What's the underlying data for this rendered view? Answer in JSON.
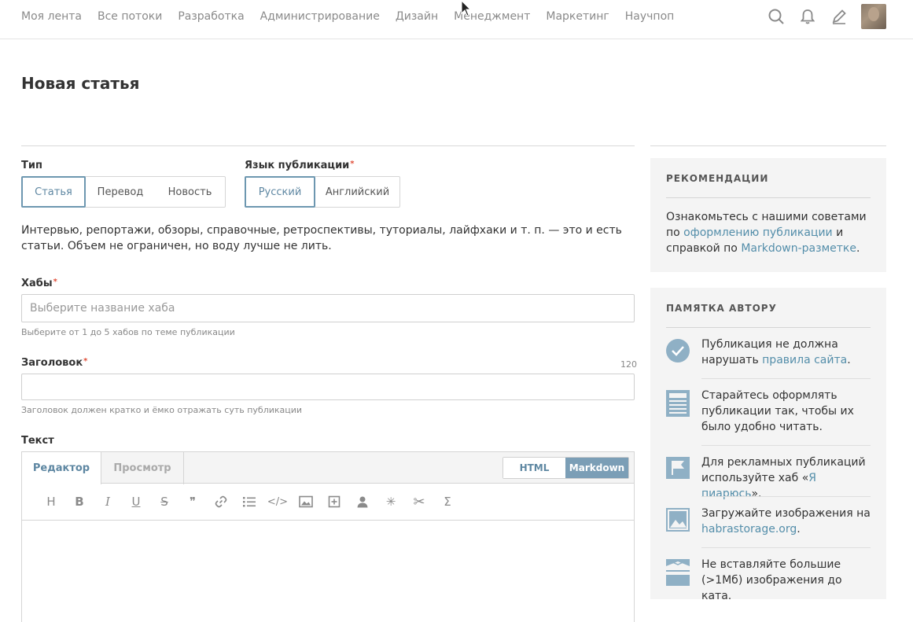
{
  "nav": {
    "items": [
      "Моя лента",
      "Все потоки",
      "Разработка",
      "Администрирование",
      "Дизайн",
      "Менеджмент",
      "Маркетинг",
      "Научпоп"
    ]
  },
  "page": {
    "title": "Новая статья"
  },
  "form": {
    "type": {
      "label": "Тип",
      "options": [
        "Статья",
        "Перевод",
        "Новость"
      ]
    },
    "language": {
      "label": "Язык публикации",
      "options": [
        "Русский",
        "Английский"
      ]
    },
    "description": "Интервью, репортажи, обзоры, справочные, ретроспективы, туториалы, лайфхаки и т. п. — это и есть статьи. Объем не ограничен, но воду лучше не лить.",
    "hubs": {
      "label": "Хабы",
      "placeholder": "Выберите название хаба",
      "hint": "Выберите от 1 до 5 хабов по теме публикации"
    },
    "heading": {
      "label": "Заголовок",
      "counter": "120",
      "value": "",
      "hint": "Заголовок должен кратко и ёмко отражать суть публикации"
    },
    "text": {
      "label": "Текст"
    }
  },
  "editor": {
    "tabs": [
      "Редактор",
      "Просмотр"
    ],
    "modes": [
      "HTML",
      "Markdown"
    ],
    "toolbar": [
      {
        "name": "heading-icon",
        "glyph": "H"
      },
      {
        "name": "bold-icon",
        "glyph": "B"
      },
      {
        "name": "italic-icon",
        "glyph": "I"
      },
      {
        "name": "underline-icon",
        "glyph": "U"
      },
      {
        "name": "strikethrough-icon",
        "glyph": "S"
      },
      {
        "name": "quote-icon",
        "glyph": "❞"
      },
      {
        "name": "link-icon",
        "glyph": "🔗"
      },
      {
        "name": "list-icon",
        "glyph": "☰"
      },
      {
        "name": "code-icon",
        "glyph": "</>"
      },
      {
        "name": "image-icon",
        "glyph": "▣"
      },
      {
        "name": "spoiler-icon",
        "glyph": "⊞"
      },
      {
        "name": "user-icon",
        "glyph": "👤"
      },
      {
        "name": "anchor-icon",
        "glyph": "✳"
      },
      {
        "name": "cut-icon",
        "glyph": "✂"
      },
      {
        "name": "formula-icon",
        "glyph": "Σ"
      }
    ]
  },
  "sidebar": {
    "recommendations": {
      "title": "РЕКОМЕНДАЦИИ",
      "text1": "Ознакомьтесь с нашими советами по ",
      "link1": "оформлению публикации",
      "text2": " и справкой по ",
      "link2": "Markdown-разметке",
      "text3": "."
    },
    "memo": {
      "title": "ПАМЯТКА АВТОРУ",
      "tips": [
        {
          "icon": "check-icon",
          "pre": "Публикация не должна нарушать ",
          "link": "правила сайта",
          "post": "."
        },
        {
          "icon": "document-icon",
          "pre": "Старайтесь оформлять публикации так, чтобы их было удобно читать.",
          "link": "",
          "post": ""
        },
        {
          "icon": "flag-icon",
          "pre": "Для рекламных публикаций используйте хаб «",
          "link": "Я пиарюсь",
          "post": "»."
        },
        {
          "icon": "image-icon",
          "pre": "Загружайте изображения на ",
          "link": "habrastorage.org",
          "post": "."
        },
        {
          "icon": "cut-line-icon",
          "pre": "Не вставляйте большие (>1Мб) изображения до ката.",
          "link": "",
          "post": ""
        }
      ]
    }
  },
  "colors": {
    "accent": "#5e87a2",
    "link": "#548eaa",
    "required": "#e04e39",
    "sidebar_bg": "#f4f4f4",
    "icon": "#8fb0c5"
  }
}
